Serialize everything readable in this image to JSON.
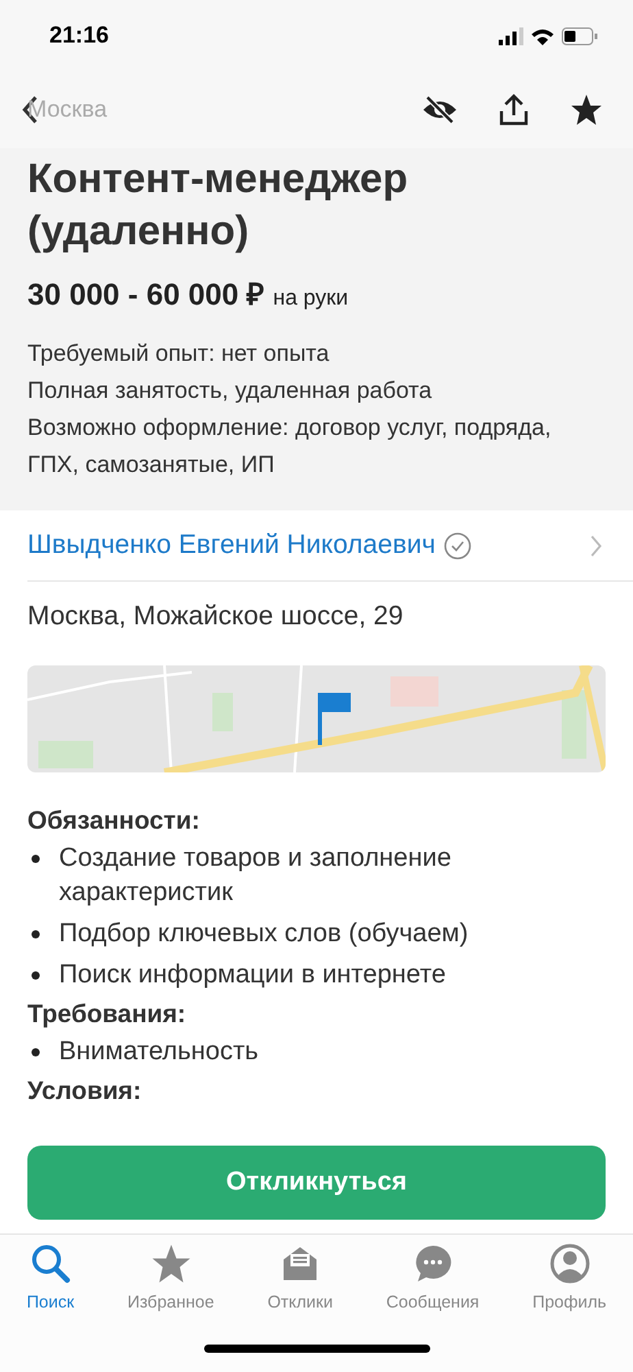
{
  "status_bar": {
    "time": "21:16"
  },
  "nav": {
    "back_label": "Москва"
  },
  "vacancy": {
    "title": "Контент-менеджер (удаленно)",
    "salary": "30 000 - 60 000 ₽",
    "salary_note": "на руки",
    "details": [
      "Требуемый опыт: нет опыта",
      "Полная занятость, удаленная работа",
      "Возможно оформление: договор услуг, подряда, ГПХ, самозанятые, ИП"
    ]
  },
  "employer": {
    "name": "Швыдченко Евгений Николаевич",
    "verified": true
  },
  "address": "Москва, Можайское шоссе, 29",
  "sections": [
    {
      "heading": "Обязанности:",
      "items": [
        "Создание товаров и заполнение характеристик",
        "Подбор ключевых слов (обучаем)",
        "Поиск информации в интернете"
      ]
    },
    {
      "heading": "Требования:",
      "items": [
        "Внимательность"
      ]
    },
    {
      "heading": "Условия:"
    }
  ],
  "apply_button": "Откликнуться",
  "tabs": [
    {
      "label": "Поиск",
      "kind": "search",
      "selected": true
    },
    {
      "label": "Избранное",
      "kind": "star",
      "selected": false
    },
    {
      "label": "Отклики",
      "kind": "envelope",
      "selected": false
    },
    {
      "label": "Сообщения",
      "kind": "chat",
      "selected": false
    },
    {
      "label": "Профиль",
      "kind": "profile",
      "selected": false
    }
  ]
}
